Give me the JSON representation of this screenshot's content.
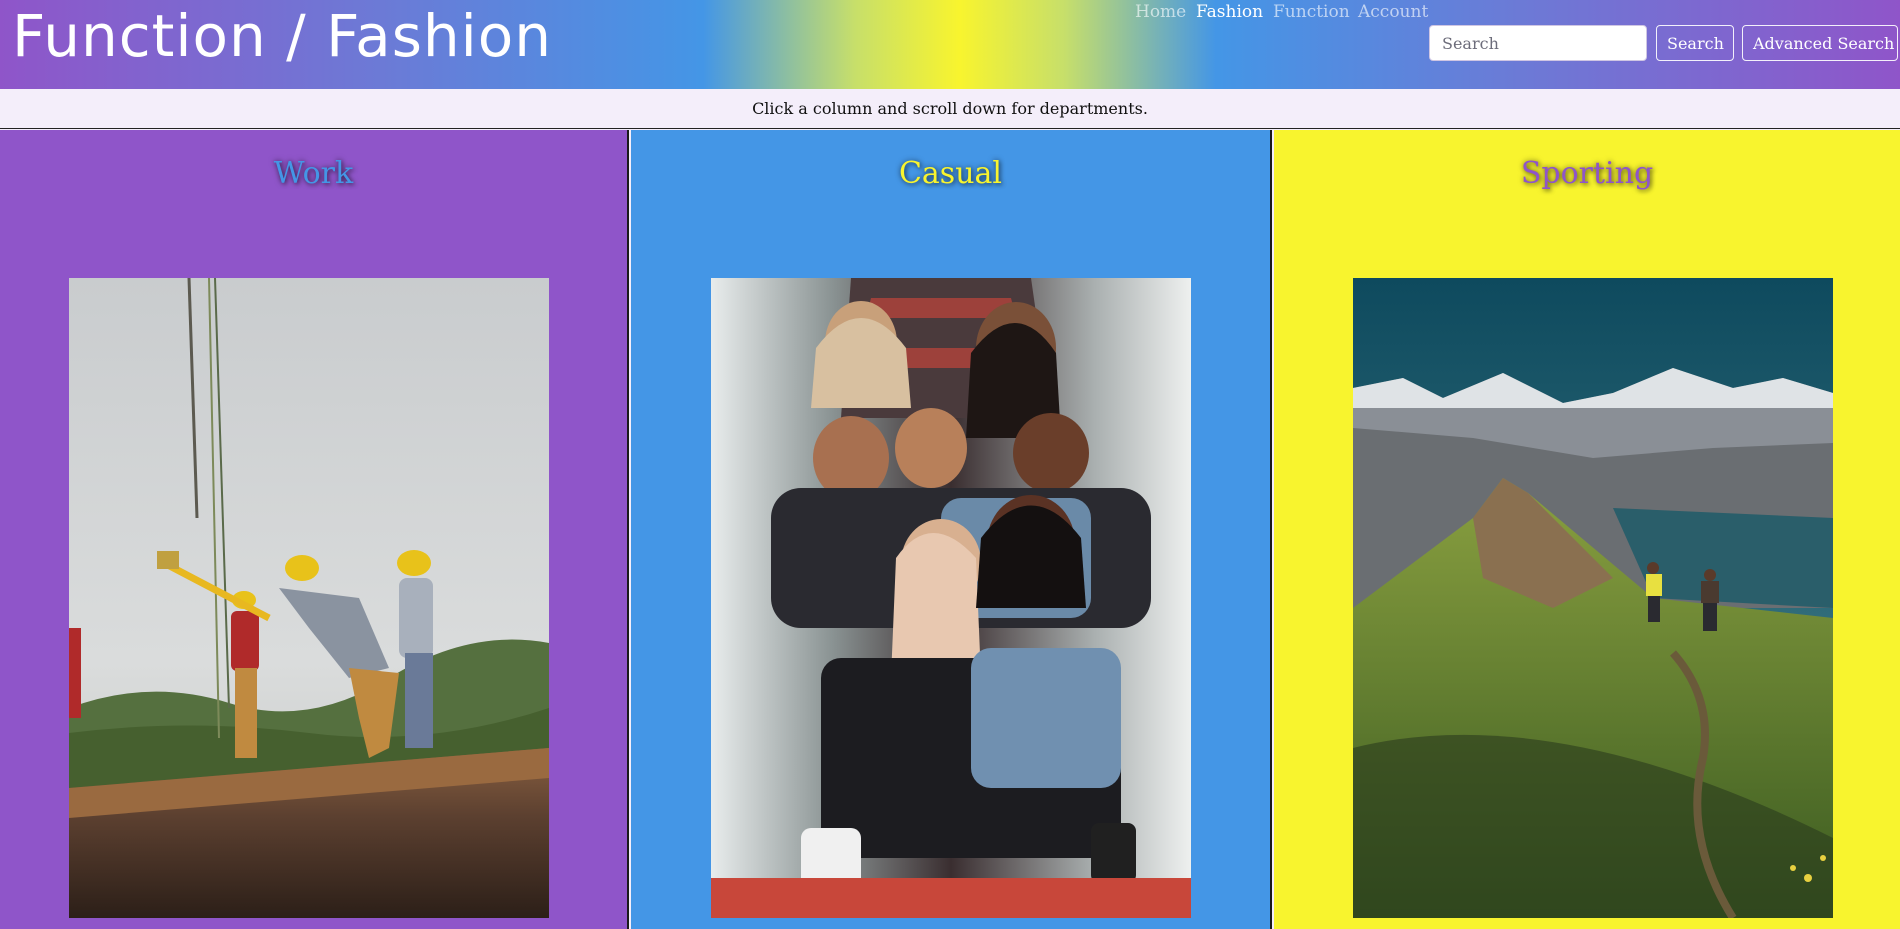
{
  "brand": "Function / Fashion",
  "nav": {
    "links": [
      "Home",
      "Fashion",
      "Function",
      "Account"
    ],
    "active": "Fashion"
  },
  "search": {
    "placeholder": "Search",
    "button_label": "Search",
    "advanced_label": "Advanced Search"
  },
  "hint": "Click a column and scroll down for departments.",
  "columns": [
    {
      "title": "Work",
      "background": "#8f55c9",
      "title_color": "#4496e6"
    },
    {
      "title": "Casual",
      "background": "#4496e6",
      "title_color": "#f8f42e"
    },
    {
      "title": "Sporting",
      "background": "#f8f42e",
      "title_color": "#8f55c9"
    }
  ],
  "colors": {
    "purple": "#8f55c9",
    "blue": "#4496e6",
    "yellow": "#f8f42e",
    "hint_bar": "#f4eefa"
  }
}
